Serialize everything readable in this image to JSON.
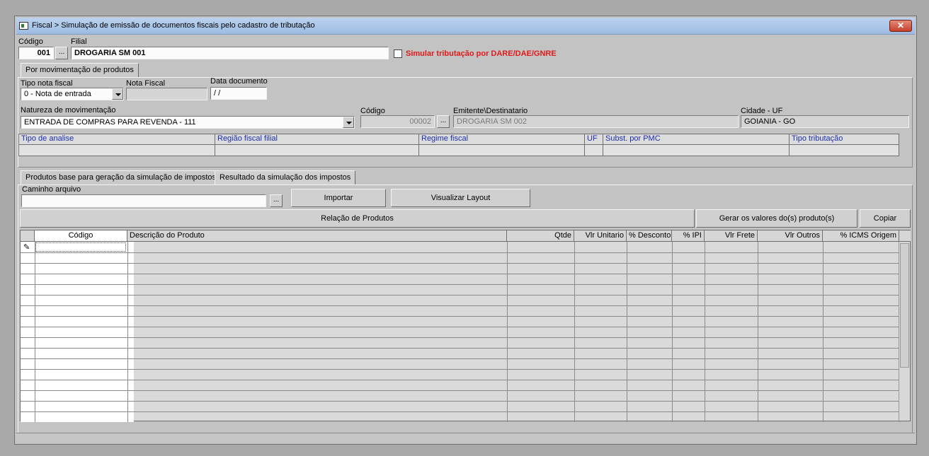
{
  "window": {
    "title": "Fiscal > Simulação de emissão de documentos fiscais pelo cadastro de tributação",
    "close_label": "✕"
  },
  "header": {
    "codigo_label": "Código",
    "codigo_value": "001",
    "filial_label": "Filial",
    "filial_value": "DROGARIA SM 001",
    "simular_label": "Simular tributação por DARE/DAE/GNRE",
    "ellipsis": "..."
  },
  "tabs_top": [
    {
      "label": "Por movimentação de produtos"
    }
  ],
  "movimento": {
    "tipo_nota_label": "Tipo nota fiscal",
    "tipo_nota_value": "0 - Nota de entrada",
    "nota_fiscal_label": "Nota Fiscal",
    "nota_fiscal_value": "",
    "data_documento_label": "Data documento",
    "data_documento_value": " /  /",
    "natureza_label": "Natureza de movimentação",
    "natureza_value": "ENTRADA DE COMPRAS PARA REVENDA - 111",
    "codigo_label": "Código",
    "codigo_value": "00002",
    "emitente_label": "Emitente\\Destinatario",
    "emitente_value": "DROGARIA SM 002",
    "cidade_label": "Cidade - UF",
    "cidade_value": "GOIANIA - GO"
  },
  "info_columns": [
    "Tipo de analise",
    "Região fiscal filial",
    "Regime fiscal",
    "UF",
    "Subst. por PMC",
    "Tipo tributação"
  ],
  "tabs_bottom": [
    {
      "label": "Produtos base para geração da simulação de impostos"
    },
    {
      "label": "Resultado da simulação dos impostos"
    }
  ],
  "produtos": {
    "caminho_label": "Caminho arquivo",
    "caminho_value": "",
    "importar_label": "Importar",
    "visualizar_label": "Visualizar Layout",
    "relacao_label": "Relação de Produtos",
    "gerar_label": "Gerar os valores do(s) produto(s)",
    "copiar_label": "Copiar"
  },
  "grid": {
    "columns": [
      "Código",
      "Descrição do Produto",
      "Qtde",
      "Vlr Unitario",
      "% Desconto",
      "% IPI",
      "Vlr Frete",
      "Vlr Outros",
      "% ICMS Origem"
    ],
    "edit_indicator_icon": "pencil-icon"
  }
}
